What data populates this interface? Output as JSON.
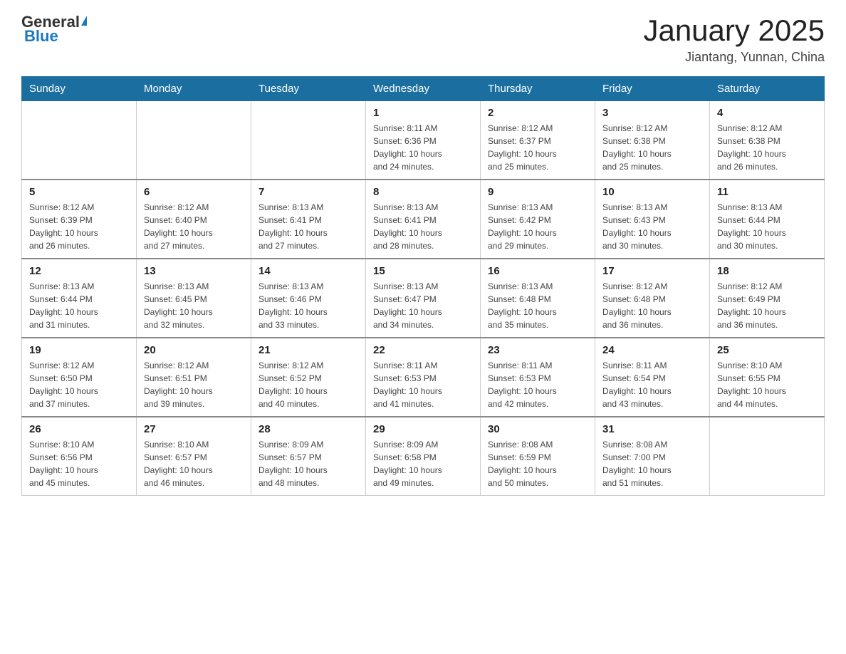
{
  "logo": {
    "general": "General",
    "blue": "Blue",
    "triangle": "▶"
  },
  "title": "January 2025",
  "subtitle": "Jiantang, Yunnan, China",
  "days": [
    "Sunday",
    "Monday",
    "Tuesday",
    "Wednesday",
    "Thursday",
    "Friday",
    "Saturday"
  ],
  "weeks": [
    [
      {
        "num": "",
        "info": ""
      },
      {
        "num": "",
        "info": ""
      },
      {
        "num": "",
        "info": ""
      },
      {
        "num": "1",
        "info": "Sunrise: 8:11 AM\nSunset: 6:36 PM\nDaylight: 10 hours\nand 24 minutes."
      },
      {
        "num": "2",
        "info": "Sunrise: 8:12 AM\nSunset: 6:37 PM\nDaylight: 10 hours\nand 25 minutes."
      },
      {
        "num": "3",
        "info": "Sunrise: 8:12 AM\nSunset: 6:38 PM\nDaylight: 10 hours\nand 25 minutes."
      },
      {
        "num": "4",
        "info": "Sunrise: 8:12 AM\nSunset: 6:38 PM\nDaylight: 10 hours\nand 26 minutes."
      }
    ],
    [
      {
        "num": "5",
        "info": "Sunrise: 8:12 AM\nSunset: 6:39 PM\nDaylight: 10 hours\nand 26 minutes."
      },
      {
        "num": "6",
        "info": "Sunrise: 8:12 AM\nSunset: 6:40 PM\nDaylight: 10 hours\nand 27 minutes."
      },
      {
        "num": "7",
        "info": "Sunrise: 8:13 AM\nSunset: 6:41 PM\nDaylight: 10 hours\nand 27 minutes."
      },
      {
        "num": "8",
        "info": "Sunrise: 8:13 AM\nSunset: 6:41 PM\nDaylight: 10 hours\nand 28 minutes."
      },
      {
        "num": "9",
        "info": "Sunrise: 8:13 AM\nSunset: 6:42 PM\nDaylight: 10 hours\nand 29 minutes."
      },
      {
        "num": "10",
        "info": "Sunrise: 8:13 AM\nSunset: 6:43 PM\nDaylight: 10 hours\nand 30 minutes."
      },
      {
        "num": "11",
        "info": "Sunrise: 8:13 AM\nSunset: 6:44 PM\nDaylight: 10 hours\nand 30 minutes."
      }
    ],
    [
      {
        "num": "12",
        "info": "Sunrise: 8:13 AM\nSunset: 6:44 PM\nDaylight: 10 hours\nand 31 minutes."
      },
      {
        "num": "13",
        "info": "Sunrise: 8:13 AM\nSunset: 6:45 PM\nDaylight: 10 hours\nand 32 minutes."
      },
      {
        "num": "14",
        "info": "Sunrise: 8:13 AM\nSunset: 6:46 PM\nDaylight: 10 hours\nand 33 minutes."
      },
      {
        "num": "15",
        "info": "Sunrise: 8:13 AM\nSunset: 6:47 PM\nDaylight: 10 hours\nand 34 minutes."
      },
      {
        "num": "16",
        "info": "Sunrise: 8:13 AM\nSunset: 6:48 PM\nDaylight: 10 hours\nand 35 minutes."
      },
      {
        "num": "17",
        "info": "Sunrise: 8:12 AM\nSunset: 6:48 PM\nDaylight: 10 hours\nand 36 minutes."
      },
      {
        "num": "18",
        "info": "Sunrise: 8:12 AM\nSunset: 6:49 PM\nDaylight: 10 hours\nand 36 minutes."
      }
    ],
    [
      {
        "num": "19",
        "info": "Sunrise: 8:12 AM\nSunset: 6:50 PM\nDaylight: 10 hours\nand 37 minutes."
      },
      {
        "num": "20",
        "info": "Sunrise: 8:12 AM\nSunset: 6:51 PM\nDaylight: 10 hours\nand 39 minutes."
      },
      {
        "num": "21",
        "info": "Sunrise: 8:12 AM\nSunset: 6:52 PM\nDaylight: 10 hours\nand 40 minutes."
      },
      {
        "num": "22",
        "info": "Sunrise: 8:11 AM\nSunset: 6:53 PM\nDaylight: 10 hours\nand 41 minutes."
      },
      {
        "num": "23",
        "info": "Sunrise: 8:11 AM\nSunset: 6:53 PM\nDaylight: 10 hours\nand 42 minutes."
      },
      {
        "num": "24",
        "info": "Sunrise: 8:11 AM\nSunset: 6:54 PM\nDaylight: 10 hours\nand 43 minutes."
      },
      {
        "num": "25",
        "info": "Sunrise: 8:10 AM\nSunset: 6:55 PM\nDaylight: 10 hours\nand 44 minutes."
      }
    ],
    [
      {
        "num": "26",
        "info": "Sunrise: 8:10 AM\nSunset: 6:56 PM\nDaylight: 10 hours\nand 45 minutes."
      },
      {
        "num": "27",
        "info": "Sunrise: 8:10 AM\nSunset: 6:57 PM\nDaylight: 10 hours\nand 46 minutes."
      },
      {
        "num": "28",
        "info": "Sunrise: 8:09 AM\nSunset: 6:57 PM\nDaylight: 10 hours\nand 48 minutes."
      },
      {
        "num": "29",
        "info": "Sunrise: 8:09 AM\nSunset: 6:58 PM\nDaylight: 10 hours\nand 49 minutes."
      },
      {
        "num": "30",
        "info": "Sunrise: 8:08 AM\nSunset: 6:59 PM\nDaylight: 10 hours\nand 50 minutes."
      },
      {
        "num": "31",
        "info": "Sunrise: 8:08 AM\nSunset: 7:00 PM\nDaylight: 10 hours\nand 51 minutes."
      },
      {
        "num": "",
        "info": ""
      }
    ]
  ]
}
